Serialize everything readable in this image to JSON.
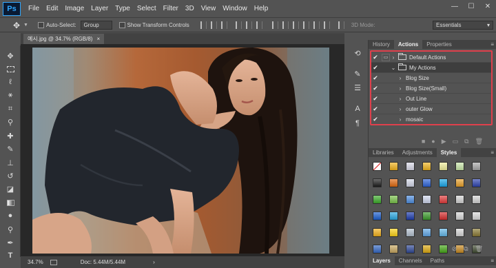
{
  "app": {
    "logo": "Ps"
  },
  "menu": [
    "File",
    "Edit",
    "Image",
    "Layer",
    "Type",
    "Select",
    "Filter",
    "3D",
    "View",
    "Window",
    "Help"
  ],
  "window_controls": {
    "minimize": "—",
    "maximize": "☐",
    "close": "✕"
  },
  "options": {
    "auto_select_label": "Auto-Select:",
    "auto_select_value": "Group",
    "show_transform_label": "Show Transform Controls",
    "mode_3d_label": "3D Mode:",
    "workspace_value": "Essentials"
  },
  "document": {
    "tab_title": "예시.jpg @ 34.7% (RGB/8)",
    "close_glyph": "×"
  },
  "status": {
    "zoom": "34.7%",
    "doc_info": "Doc: 5.44M/5.44M",
    "arrow": "›"
  },
  "panels": {
    "top_tabs": [
      "History",
      "Actions",
      "Properties"
    ],
    "top_active": "Actions",
    "actions": [
      {
        "name": "Default Actions",
        "type": "set",
        "expanded": false
      },
      {
        "name": "My Actions",
        "type": "set",
        "expanded": true
      },
      {
        "name": "Blog Size",
        "type": "action"
      },
      {
        "name": "Blog Size(Small)",
        "type": "action"
      },
      {
        "name": "Out Line",
        "type": "action"
      },
      {
        "name": "outer Glow",
        "type": "action"
      },
      {
        "name": "mosaic",
        "type": "action"
      }
    ],
    "mid_tabs": [
      "Libraries",
      "Adjustments",
      "Styles"
    ],
    "mid_active": "Styles",
    "bottom_tabs": [
      "Layers",
      "Channels",
      "Paths"
    ],
    "bottom_active": "Layers"
  },
  "style_swatches": [
    "#ffffff",
    "#f2b21b",
    "#d9d9e8",
    "#f1b51f",
    "#f0ee9a",
    "#c8e6a8",
    "#a8a8a8",
    "#1d1d1d",
    "#e16a10",
    "#d4d8e8",
    "#2e64d8",
    "#1aa8e8",
    "#e9a12a",
    "#2e44b0",
    "#3cad2a",
    "#79c24a",
    "#4f8fe0",
    "#cfd6ec",
    "#e23b3b",
    "#d4d4d4",
    "#d5d5d5",
    "#1c5fd0",
    "#2aa8e0",
    "#1e3cae",
    "#3a9a2a",
    "#d62d2d",
    "#d7d7d7",
    "#dadada",
    "#f2b11c",
    "#fcd316",
    "#b3c0cf",
    "#61a8e8",
    "#63b7e8",
    "#d7d7d7",
    "#8a7a34",
    "#3468c4",
    "#c8a860",
    "#2f4896",
    "#ddaa12",
    "#46a818",
    "#c88a20",
    "#3f4a30"
  ],
  "colors": {
    "highlight_box": "#e0404c",
    "panel_bg": "#535353",
    "accent": "#31a8ff"
  }
}
